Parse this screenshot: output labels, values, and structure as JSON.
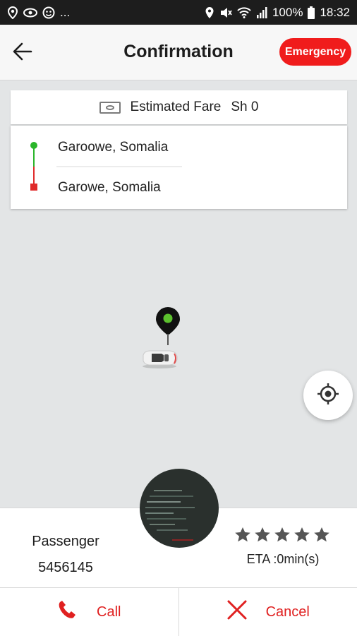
{
  "status_bar": {
    "dots": "...",
    "battery": "100%",
    "time": "18:32",
    "icons": [
      "location-pin-icon",
      "eye-icon",
      "emoji-icon",
      "location-icon",
      "mute-icon",
      "wifi-icon",
      "signal-icon",
      "battery-icon"
    ]
  },
  "header": {
    "title": "Confirmation",
    "emergency_label": "Emergency",
    "back_icon": "arrow-left-icon"
  },
  "fare": {
    "label": "Estimated Fare",
    "amount": "Sh 0",
    "icon": "cash-icon"
  },
  "route": {
    "pickup": "Garoowe, Somalia",
    "dropoff": "Garowe, Somalia"
  },
  "map": {
    "locate_icon": "crosshair-icon"
  },
  "passenger": {
    "label": "Passenger",
    "id": "5456145",
    "rating": 5,
    "eta": "ETA :0min(s)"
  },
  "actions": {
    "call_label": "Call",
    "cancel_label": "Cancel"
  },
  "colors": {
    "accent": "#e02020",
    "pickup": "#2ab52a",
    "dropoff": "#e02b2b"
  }
}
